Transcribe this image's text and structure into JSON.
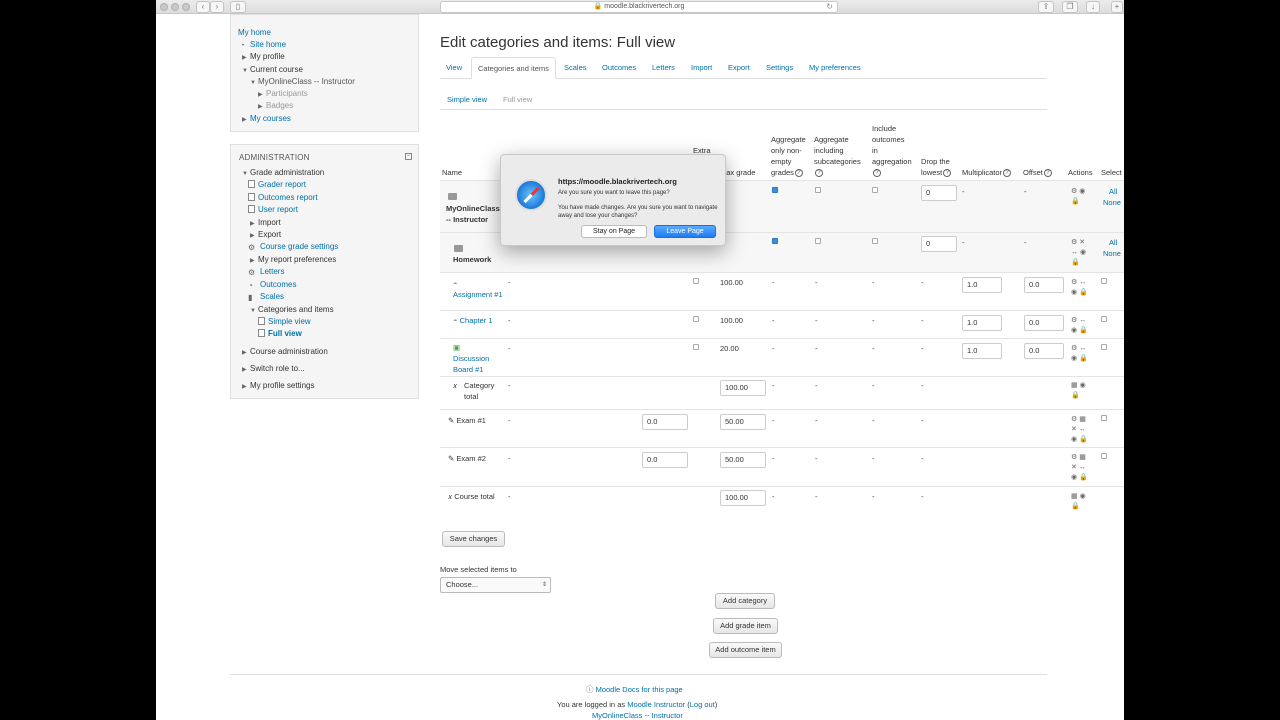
{
  "browser": {
    "url": "moodle.blackrivertech.org"
  },
  "nav": {
    "items": [
      {
        "label": "My home",
        "kind": "link"
      },
      {
        "label": "Site home",
        "kind": "link"
      },
      {
        "label": "My profile",
        "kind": "text"
      },
      {
        "label": "Current course",
        "kind": "text"
      },
      {
        "label": "MyOnlineClass -- Instructor",
        "kind": "text"
      },
      {
        "label": "Participants",
        "kind": "muted"
      },
      {
        "label": "Badges",
        "kind": "muted"
      },
      {
        "label": "My courses",
        "kind": "link"
      }
    ]
  },
  "admin": {
    "title": "ADMINISTRATION",
    "items": [
      {
        "label": "Grade administration"
      },
      {
        "label": "Grader report"
      },
      {
        "label": "Outcomes report"
      },
      {
        "label": "User report"
      },
      {
        "label": "Import"
      },
      {
        "label": "Export"
      },
      {
        "label": "Course grade settings"
      },
      {
        "label": "My report preferences"
      },
      {
        "label": "Letters"
      },
      {
        "label": "Outcomes"
      },
      {
        "label": "Scales"
      },
      {
        "label": "Categories and items"
      },
      {
        "label": "Simple view"
      },
      {
        "label": "Full view"
      },
      {
        "label": "Course administration"
      },
      {
        "label": "Switch role to..."
      },
      {
        "label": "My profile settings"
      }
    ]
  },
  "page": {
    "heading": "Edit categories and items: Full view",
    "tabs": [
      "View",
      "Categories and items",
      "Scales",
      "Outcomes",
      "Letters",
      "Import",
      "Export",
      "Settings",
      "My preferences"
    ],
    "subtabs": [
      "Simple view",
      "Full view"
    ]
  },
  "grid": {
    "headers": {
      "name": "Name",
      "extra": "Extra",
      "maxgrade": "Max grade",
      "agg_nonempty": [
        "Aggregate",
        "only non-",
        "empty",
        "grades"
      ],
      "agg_sub": [
        "Aggregate",
        "including",
        "subcategories"
      ],
      "include_outcomes": [
        "Include",
        "outcomes",
        "in",
        "aggregation"
      ],
      "drop_lowest": [
        "Drop the",
        "lowest"
      ],
      "multiplicator": "Multiplicator",
      "offset": "Offset",
      "actions": "Actions",
      "select": "Select"
    },
    "dash": "-",
    "select_all": "All",
    "select_none": "None",
    "category_top": {
      "name": "MyOnlineClass -- Instructor",
      "drop": "0"
    },
    "category_hw": {
      "name": "Homework",
      "drop": "0"
    },
    "items": [
      {
        "name": "Assignment #1",
        "max": "100.00",
        "mult": "1.0",
        "offset": "0.0"
      },
      {
        "name": "Chapter 1",
        "max": "100.00",
        "mult": "1.0",
        "offset": "0.0"
      },
      {
        "name": "Discussion Board #1",
        "max": "20.00",
        "mult": "1.0",
        "offset": "0.0"
      }
    ],
    "category_total": {
      "name": "Category total",
      "max": "100.00"
    },
    "exams": [
      {
        "name": "Exam #1",
        "weight": "0.0",
        "max": "50.00"
      },
      {
        "name": "Exam #2",
        "weight": "0.0",
        "max": "50.00"
      }
    ],
    "course_total": {
      "name": "Course total",
      "max": "100.00"
    }
  },
  "buttons": {
    "save": "Save changes",
    "move_label": "Move selected items to",
    "move_choose": "Choose...",
    "add_category": "Add category",
    "add_grade_item": "Add grade item",
    "add_outcome_item": "Add outcome item"
  },
  "footer": {
    "docs": "Moodle Docs for this page",
    "logged_prefix": "You are logged in as ",
    "user": "Moodle Instructor",
    "logout": "Log out",
    "course": "MyOnlineClass -- Instructor"
  },
  "dialog": {
    "title": "https://moodle.blackrivertech.org",
    "question": "Are you sure you want to leave this page?",
    "message": "You have made changes. Are you sure you want to navigate away and lose your changes?",
    "stay": "Stay on Page",
    "leave": "Leave Page"
  }
}
